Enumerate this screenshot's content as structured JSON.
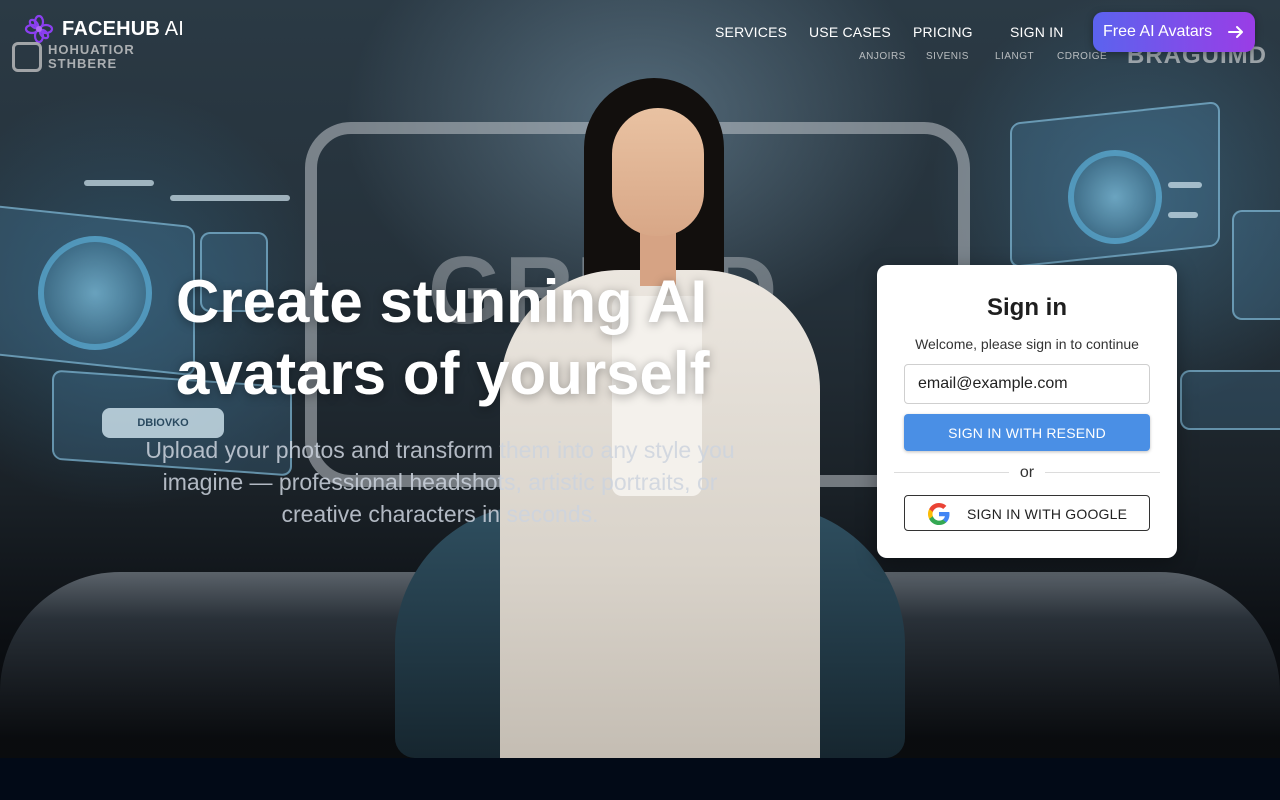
{
  "brand": {
    "name_bold": "FACEHUB",
    "name_light": " AI",
    "logo_icon": "flower-logo-icon",
    "ghost_logo_text_line1": "HOHUATIOR",
    "ghost_logo_text_line2": "STHBERE"
  },
  "nav": {
    "items": [
      {
        "label": "SERVICES"
      },
      {
        "label": "USE CASES"
      },
      {
        "label": "PRICING"
      },
      {
        "label": "SIGN IN"
      }
    ],
    "ghost_items": [
      "ANJOIRS",
      "SIVENIS",
      "LIANGT",
      "CDROIGE"
    ],
    "ghost_brand": "BRAGUIMD",
    "cta_label": "Free AI Avatars",
    "cta_icon": "arrow-right-icon"
  },
  "hero": {
    "headline_line1": "Create stunning AI",
    "headline_line2": "avatars of yourself",
    "subtext": "Upload your photos and transform them into any style you imagine — professional headshots, artistic portraits, or creative characters in seconds.",
    "background_word": "GRLND",
    "panel_pill_text": "DBIOVKO"
  },
  "signin": {
    "title": "Sign in",
    "subtitle": "Welcome, please sign in to continue",
    "email_value": "email@example.com",
    "email_placeholder": "email@example.com",
    "resend_label": "SIGN IN WITH RESEND",
    "divider_text": "or",
    "google_label": "SIGN IN WITH GOOGLE",
    "google_icon": "google-g-icon"
  },
  "colors": {
    "cta_gradient_start": "#5b63ee",
    "cta_gradient_end": "#9a3de6",
    "resend_button": "#4a8fe5",
    "page_bottom": "#020a17"
  }
}
